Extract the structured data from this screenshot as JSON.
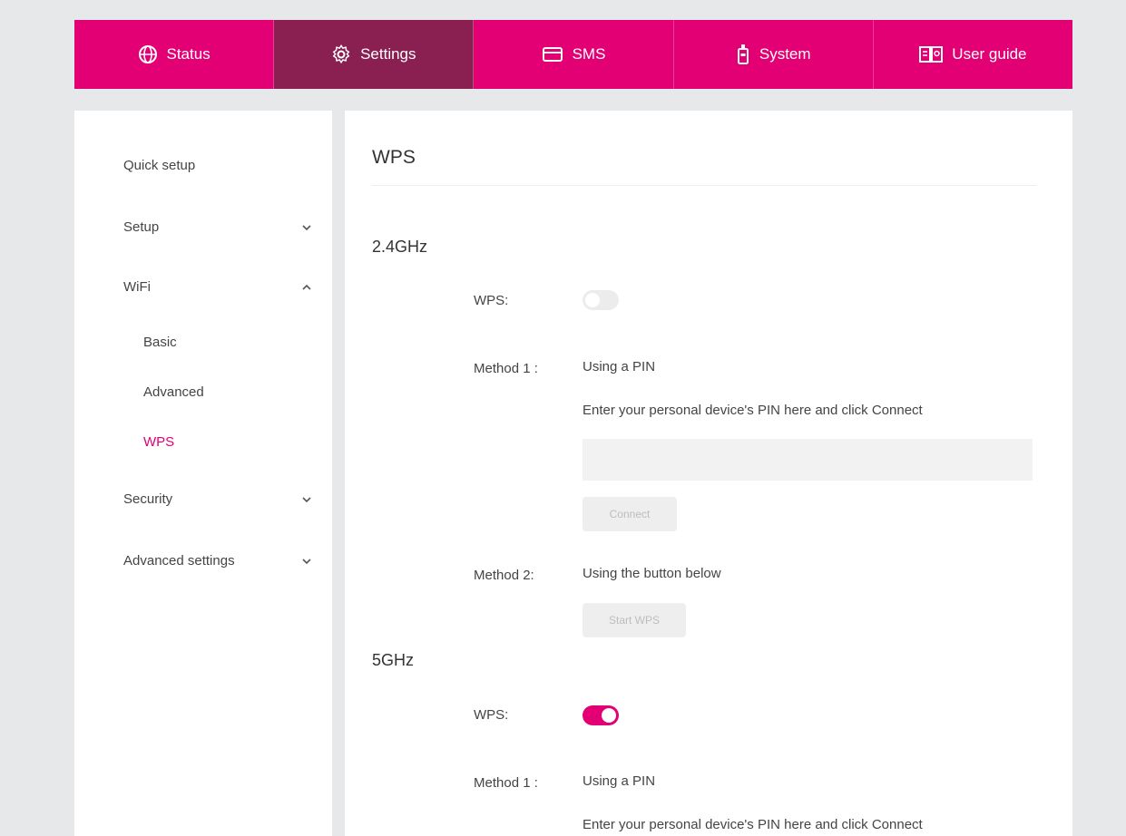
{
  "nav": {
    "tabs": [
      {
        "label": "Status",
        "icon": "globe-icon",
        "active": false
      },
      {
        "label": "Settings",
        "icon": "gear-icon",
        "active": true
      },
      {
        "label": "SMS",
        "icon": "mail-icon",
        "active": false
      },
      {
        "label": "System",
        "icon": "device-icon",
        "active": false
      },
      {
        "label": "User guide",
        "icon": "book-icon",
        "active": false
      }
    ]
  },
  "sidebar": {
    "quick_setup": "Quick setup",
    "setup": "Setup",
    "wifi": "WiFi",
    "wifi_sub": [
      "Basic",
      "Advanced",
      "WPS"
    ],
    "security": "Security",
    "advanced_settings": "Advanced settings"
  },
  "main": {
    "title": "WPS",
    "band_24": {
      "title": "2.4GHz",
      "wps_label": "WPS:",
      "wps_on": false,
      "method1_label": "Method 1 :",
      "method1_value": "Using a PIN",
      "pin_hint": "Enter your personal device's PIN here and click Connect",
      "pin_value": "",
      "connect_label": "Connect",
      "method2_label": "Method 2:",
      "method2_value": "Using the button below",
      "start_wps_label": "Start WPS"
    },
    "band_5": {
      "title": "5GHz",
      "wps_label": "WPS:",
      "wps_on": true,
      "method1_label": "Method 1 :",
      "method1_value": "Using a PIN",
      "pin_hint": "Enter your personal device's PIN here and click Connect"
    }
  },
  "colors": {
    "brand": "#e20074",
    "nav_active": "#8a1f52",
    "sidebar_active": "#e20074"
  }
}
